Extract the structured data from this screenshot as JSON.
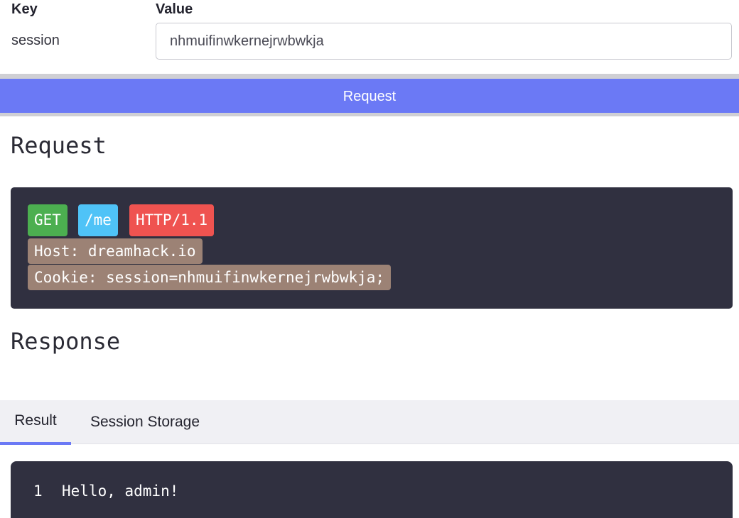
{
  "form": {
    "key_header": "Key",
    "value_header": "Value",
    "row_key": "session",
    "row_value": "nhmuifinwkernejrwbwkja"
  },
  "request_button": {
    "label": "Request"
  },
  "request_section": {
    "title": "Request",
    "method": "GET",
    "path": "/me",
    "protocol": "HTTP/1.1",
    "host_line": "Host: dreamhack.io",
    "cookie_line": "Cookie: session=nhmuifinwkernejrwbwkja;"
  },
  "response_section": {
    "title": "Response"
  },
  "tabs": [
    {
      "label": "Result",
      "active": true
    },
    {
      "label": "Session Storage",
      "active": false
    }
  ],
  "result": {
    "line_number": "1",
    "line_text": "Hello, admin!"
  },
  "colors": {
    "accent": "#6b79f5",
    "panel_bg": "#303040",
    "method_bg": "#4caf50",
    "path_bg": "#4fc3f7",
    "protocol_bg": "#ef5350",
    "header_bg": "#9c8275"
  }
}
